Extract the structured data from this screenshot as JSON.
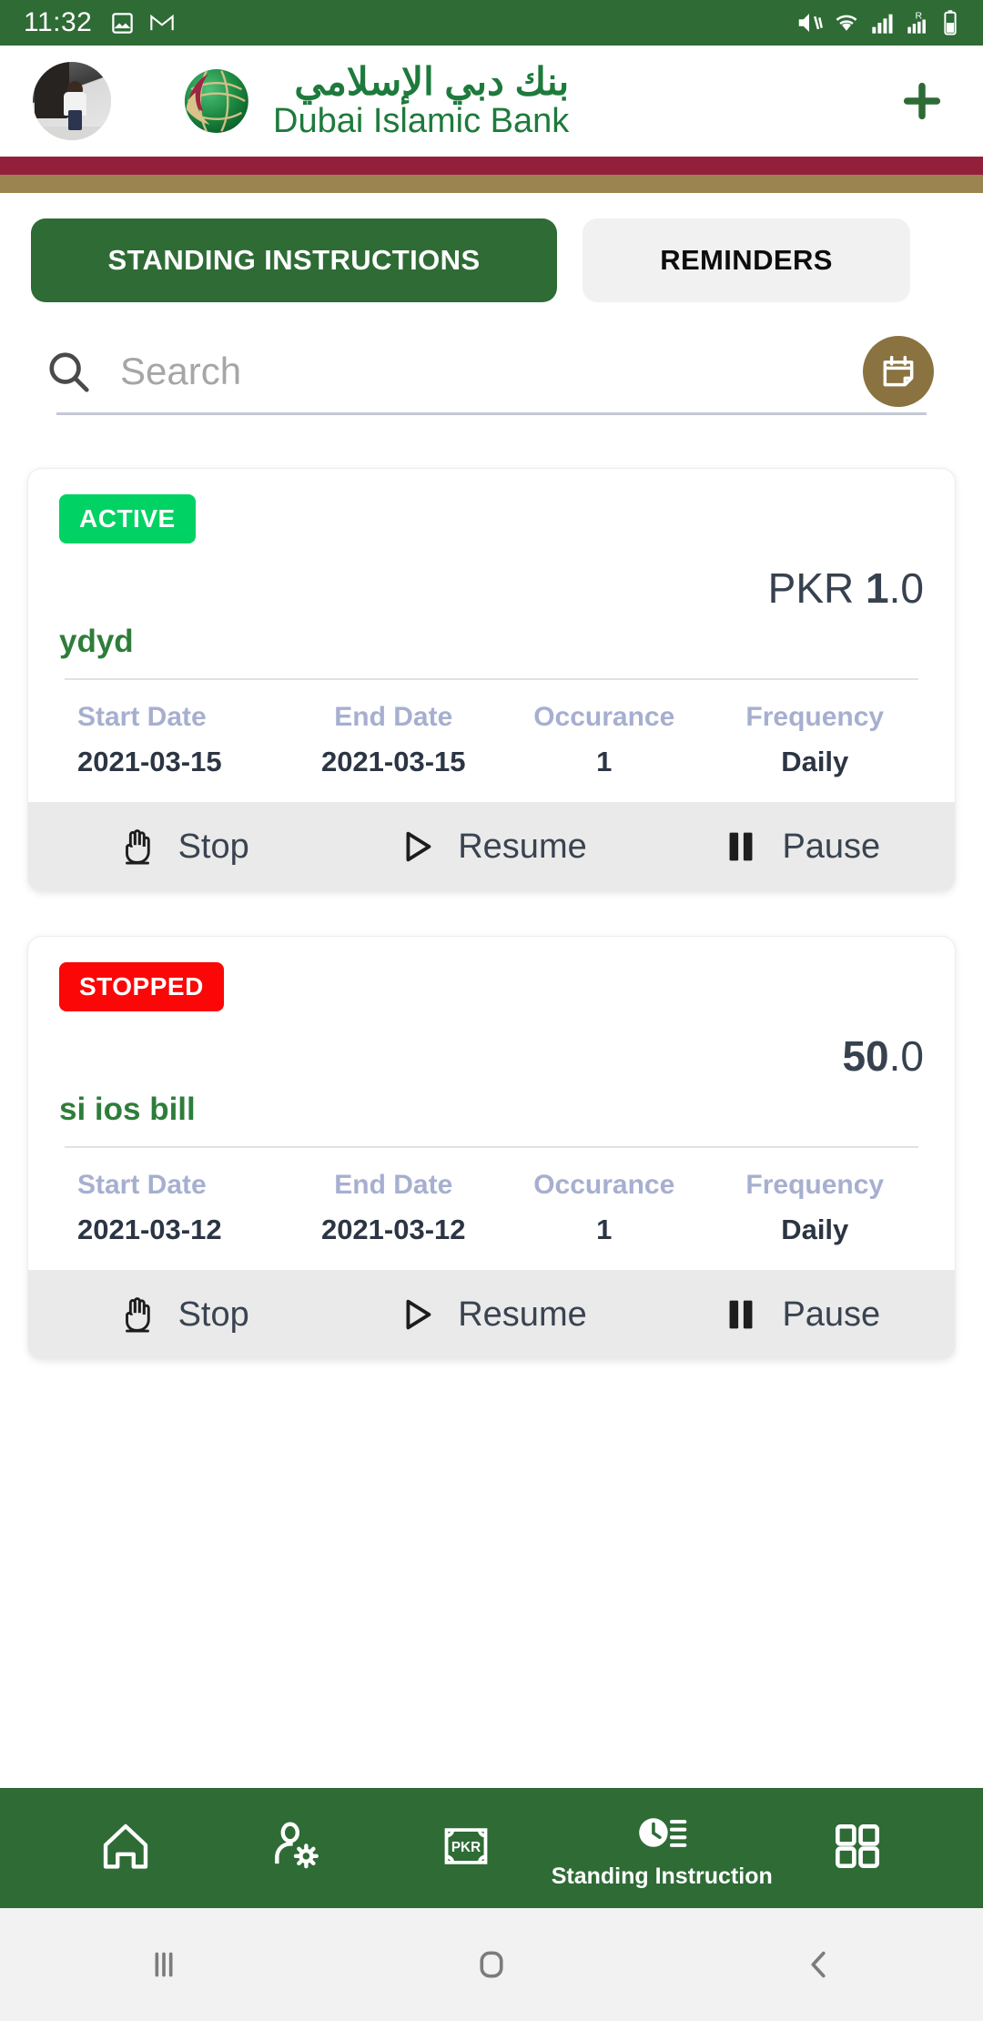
{
  "status_bar": {
    "time": "11:32",
    "left_icons": [
      "image-icon",
      "gmail-icon"
    ],
    "right_icons": [
      "mute-icon",
      "wifi-icon",
      "signal-icon",
      "roaming-signal-icon",
      "battery-icon"
    ]
  },
  "header": {
    "avatar_alt": "user-avatar",
    "logo_alt": "dubai-islamic-bank-logo",
    "brand_arabic": "بنك دبي الإسلامي",
    "brand_english": "Dubai Islamic Bank",
    "add_label": "+",
    "brand_green": "#1E7A3C",
    "stripe_maroon": "#92203B",
    "stripe_gold": "#9C8450"
  },
  "tabs": [
    {
      "label": "STANDING INSTRUCTIONS",
      "active": true
    },
    {
      "label": "REMINDERS",
      "active": false
    }
  ],
  "search": {
    "placeholder": "Search",
    "value": "",
    "calendar_button": "calendar-icon",
    "calendar_color": "#8A7340"
  },
  "cards": [
    {
      "status": "ACTIVE",
      "status_color": "#00D264",
      "currency": "PKR ",
      "amount_bold": "1",
      "amount_rest": ".0",
      "title": "ydyd",
      "meta": [
        {
          "header": "Start Date",
          "value": "2021-03-15"
        },
        {
          "header": "End Date",
          "value": "2021-03-15"
        },
        {
          "header": "Occurance",
          "value": "1"
        },
        {
          "header": "Frequency",
          "value": "Daily"
        }
      ],
      "actions": [
        {
          "label": "Stop",
          "icon": "hand-stop-icon"
        },
        {
          "label": "Resume",
          "icon": "play-icon"
        },
        {
          "label": "Pause",
          "icon": "pause-icon"
        }
      ]
    },
    {
      "status": "STOPPED",
      "status_color": "#FB0707",
      "currency": "",
      "amount_bold": "50",
      "amount_rest": ".0",
      "title": "si ios bill",
      "meta": [
        {
          "header": "Start Date",
          "value": "2021-03-12"
        },
        {
          "header": "End Date",
          "value": "2021-03-12"
        },
        {
          "header": "Occurance",
          "value": "1"
        },
        {
          "header": "Frequency",
          "value": "Daily"
        }
      ],
      "actions": [
        {
          "label": "Stop",
          "icon": "hand-stop-icon"
        },
        {
          "label": "Resume",
          "icon": "play-icon"
        },
        {
          "label": "Pause",
          "icon": "pause-icon"
        }
      ]
    }
  ],
  "bottom_nav": {
    "background": "#2E6B35",
    "items": [
      {
        "icon": "home-icon",
        "label": ""
      },
      {
        "icon": "user-settings-icon",
        "label": ""
      },
      {
        "icon": "pkr-banknote-icon",
        "label": ""
      },
      {
        "icon": "clock-list-icon",
        "label": "Standing Instruction"
      },
      {
        "icon": "grid-apps-icon",
        "label": ""
      }
    ]
  },
  "android_nav": {
    "recents": "recents-icon",
    "home": "home-square-icon",
    "back": "back-chevron-icon"
  }
}
